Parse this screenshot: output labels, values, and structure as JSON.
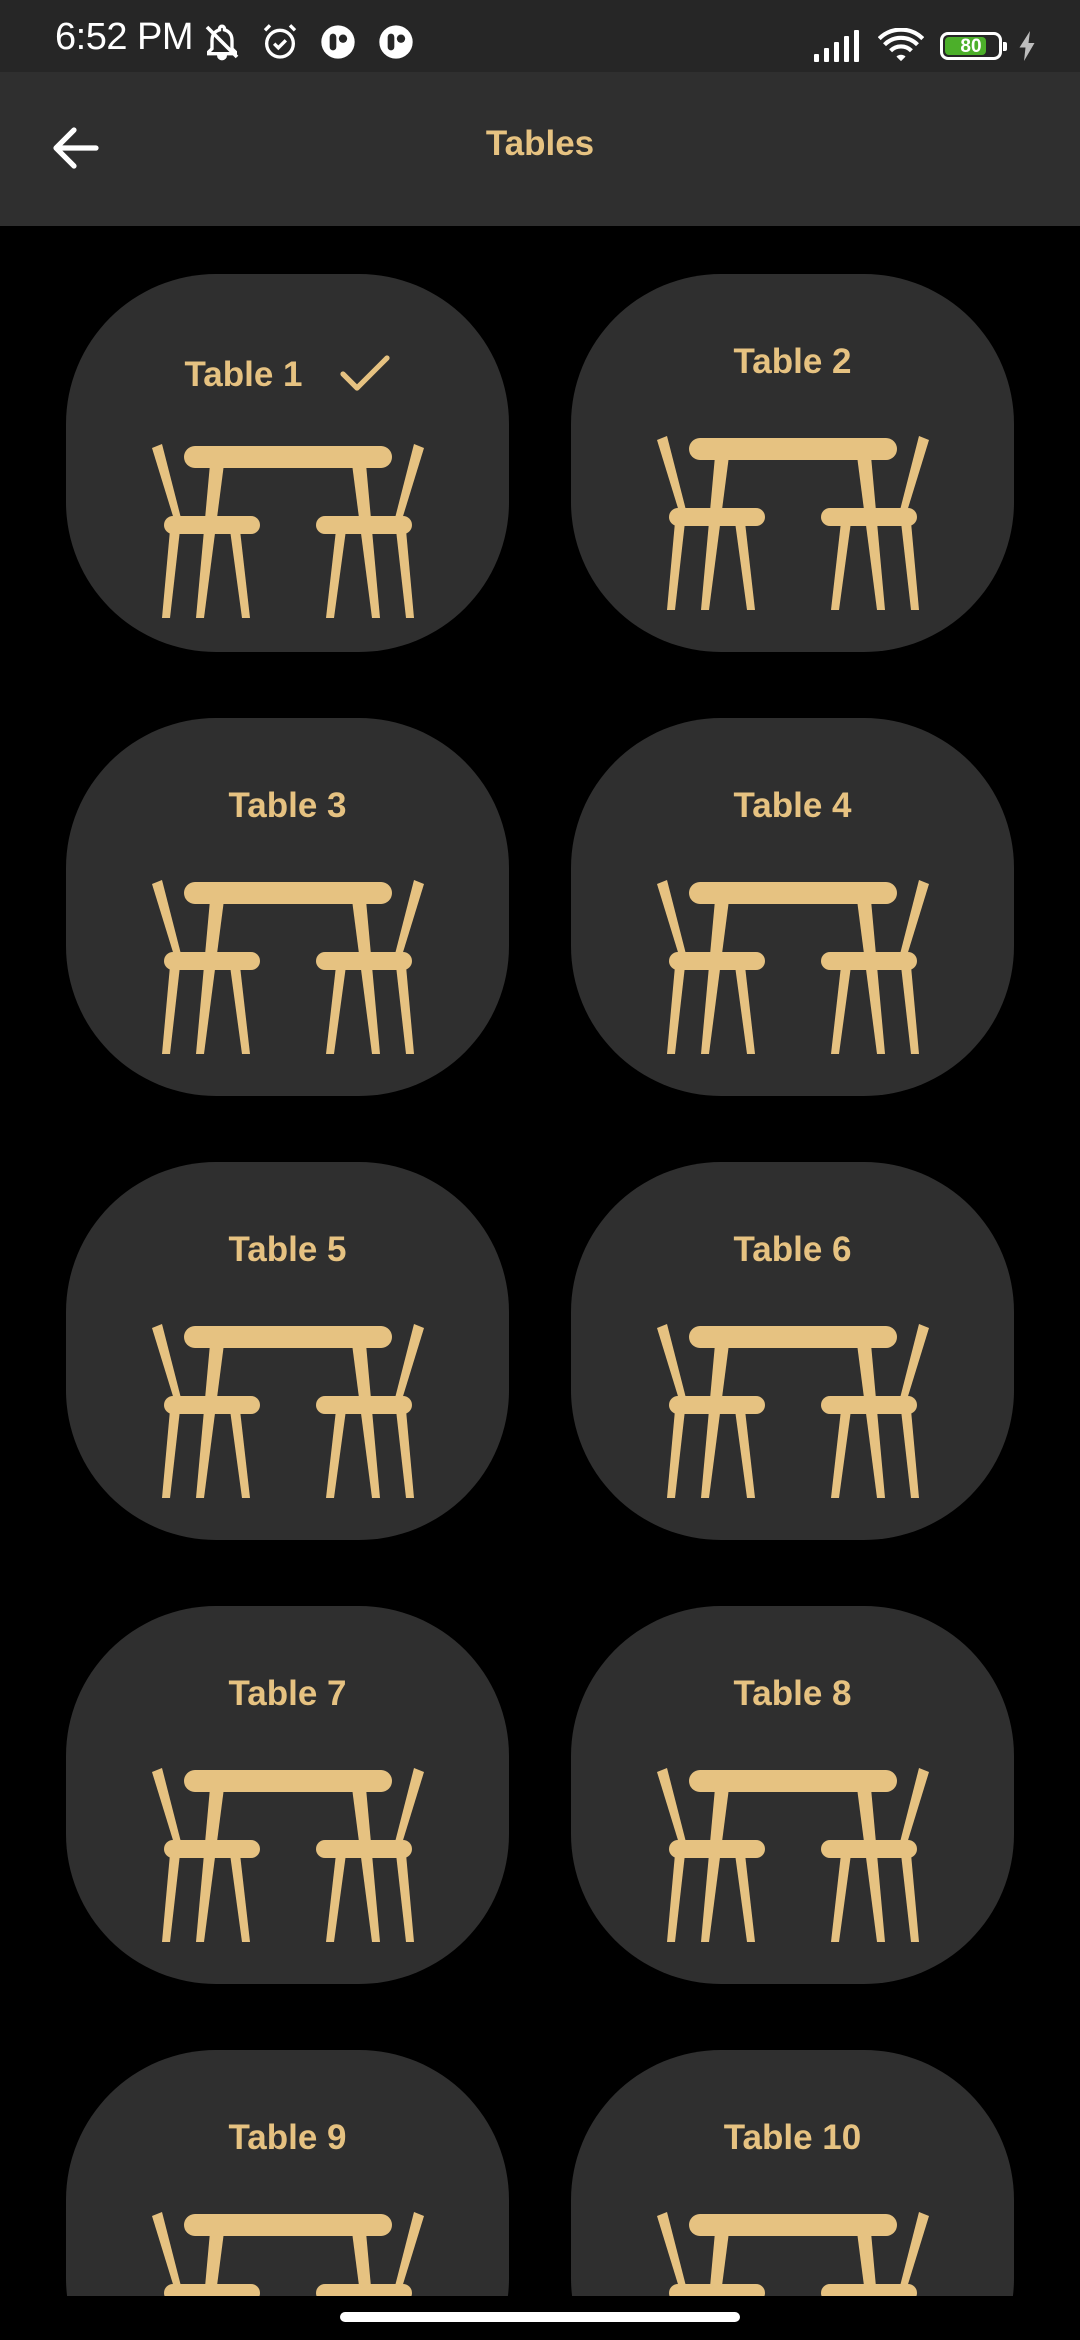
{
  "status_bar": {
    "time": "6:52 PM",
    "battery_level": "80",
    "battery_fraction": 0.8,
    "left_icons": [
      "bell-off-icon",
      "alarm-icon",
      "app-notification-icon",
      "app-notification-icon"
    ],
    "right_icons": [
      "signal-icon",
      "wifi-icon",
      "battery-icon",
      "charging-icon"
    ]
  },
  "app_bar": {
    "title": "Tables",
    "back_icon": "arrow-left-icon"
  },
  "colors": {
    "background": "#000000",
    "card": "#2f2f2f",
    "app_bar": "#2f2f2f",
    "status_bar": "#262626",
    "accent": "#e6c281",
    "battery_fill": "#4caf2a"
  },
  "tables": [
    {
      "label": "Table 1",
      "selected": true
    },
    {
      "label": "Table 2",
      "selected": false
    },
    {
      "label": "Table 3",
      "selected": false
    },
    {
      "label": "Table 4",
      "selected": false
    },
    {
      "label": "Table 5",
      "selected": false
    },
    {
      "label": "Table 6",
      "selected": false
    },
    {
      "label": "Table 7",
      "selected": false
    },
    {
      "label": "Table 8",
      "selected": false
    },
    {
      "label": "Table 9",
      "selected": false
    },
    {
      "label": "Table 10",
      "selected": false
    }
  ]
}
